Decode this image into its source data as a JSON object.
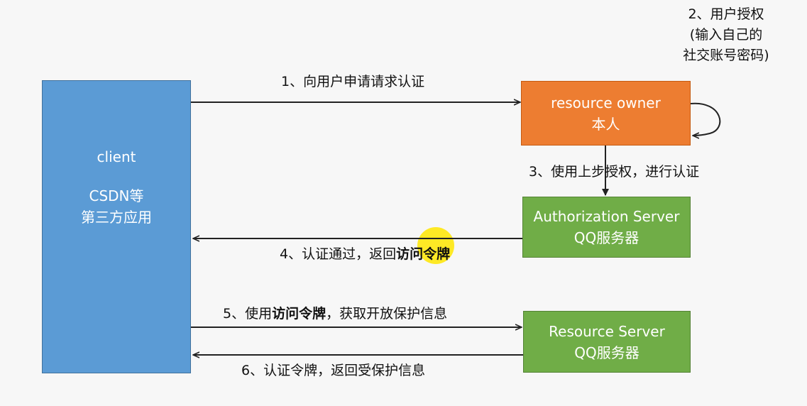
{
  "boxes": {
    "client": {
      "title": "client",
      "line1": "CSDN等",
      "line2": "第三方应用",
      "color": "#5b9bd5"
    },
    "resource_owner": {
      "line1": "resource owner",
      "line2": "本人",
      "color": "#ed7d31"
    },
    "authorization_server": {
      "line1": "Authorization Server",
      "line2": "QQ服务器",
      "color": "#70ad47"
    },
    "resource_server": {
      "line1": "Resource Server",
      "line2": "QQ服务器",
      "color": "#70ad47"
    }
  },
  "steps": {
    "step1": "1、向用户申请请求认证",
    "step2": {
      "line1": "2、用户授权",
      "line2": "(输入自己的",
      "line3": "社交账号密码)"
    },
    "step3": "3、使用上步授权，进行认证",
    "step4": {
      "prefix": "4、认证通过，返回",
      "bold": "访问令牌"
    },
    "step5": {
      "prefix": "5、使用",
      "bold": "访问令牌",
      "suffix": "，获取开放保护信息"
    },
    "step6": "6、认证令牌，返回受保护信息"
  }
}
